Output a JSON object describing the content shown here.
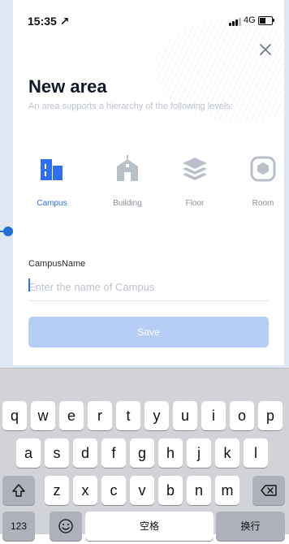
{
  "status_bar": {
    "time": "15:35 ↗",
    "network": "4G"
  },
  "header": {
    "title": "New area",
    "subtitle": "An area supports a hierarchy of the following levels:"
  },
  "levels": [
    {
      "label": "Campus",
      "icon": "campus-icon",
      "active": true
    },
    {
      "label": "Building",
      "icon": "building-icon",
      "active": false
    },
    {
      "label": "Floor",
      "icon": "floor-icon",
      "active": false
    },
    {
      "label": "Room",
      "icon": "room-icon",
      "active": false
    }
  ],
  "form": {
    "field_label": "CampusName",
    "placeholder": "Enter the name of Campus",
    "value": "",
    "save_label": "Save"
  },
  "keyboard": {
    "row1": [
      "q",
      "w",
      "e",
      "r",
      "t",
      "y",
      "u",
      "i",
      "o",
      "p"
    ],
    "row2": [
      "a",
      "s",
      "d",
      "f",
      "g",
      "h",
      "j",
      "k",
      "l"
    ],
    "row3": [
      "z",
      "x",
      "c",
      "v",
      "b",
      "n",
      "m"
    ],
    "numbers_label": "123",
    "space_label": "空格",
    "return_label": "换行",
    "shift_icon": "shift-icon",
    "delete_icon": "delete-icon",
    "emoji_icon": "emoji-icon"
  },
  "colors": {
    "accent": "#2f6ff3",
    "save_disabled": "#b6cdf6",
    "inactive_icon": "#b9c0c9"
  }
}
